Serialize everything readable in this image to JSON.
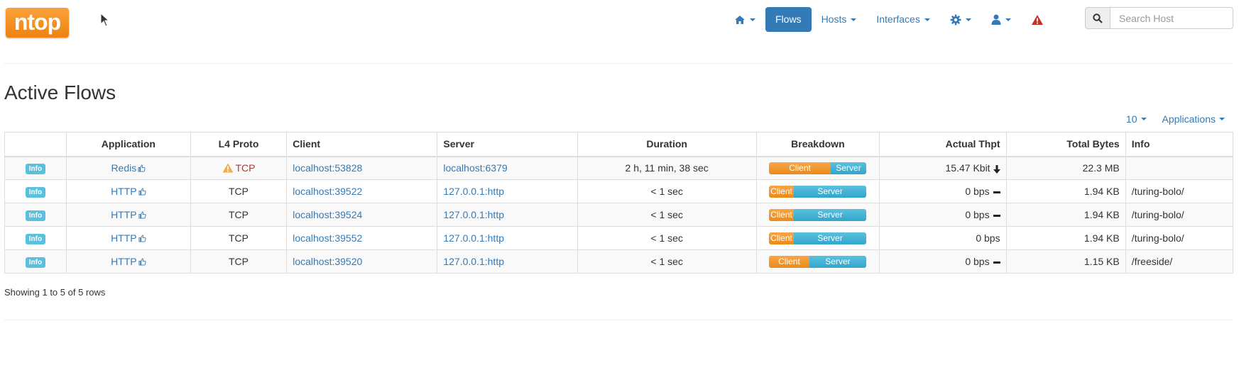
{
  "logo": "ntop",
  "nav": {
    "flows_label": "Flows",
    "hosts_label": "Hosts",
    "interfaces_label": "Interfaces"
  },
  "search": {
    "placeholder": "Search Host"
  },
  "page_title": "Active Flows",
  "table_tools": {
    "page_size": "10",
    "applications_label": "Applications"
  },
  "columns": [
    "",
    "Application",
    "L4 Proto",
    "Client",
    "Server",
    "Duration",
    "Breakdown",
    "Actual Thpt",
    "Total Bytes",
    "Info"
  ],
  "rows": [
    {
      "info": "Info",
      "app": "Redis",
      "proto": "TCP",
      "proto_warning": true,
      "client_host": "localhost",
      "client_port": ":53828",
      "server_host": "localhost",
      "server_port": ":6379",
      "duration": "2 h, 11 min, 38 sec",
      "client_label": "Client",
      "server_label": "Server",
      "client_pct": 63,
      "thpt": "15.47 Kbit",
      "trend": "down",
      "bytes": "22.3 MB",
      "info_text": ""
    },
    {
      "info": "Info",
      "app": "HTTP",
      "proto": "TCP",
      "proto_warning": false,
      "client_host": "localhost",
      "client_port": ":39522",
      "server_host": "127.0.0.1",
      "server_port": ":http",
      "duration": "< 1 sec",
      "client_label": "Client",
      "server_label": "Server",
      "client_pct": 25,
      "thpt": "0 bps",
      "trend": "flat",
      "bytes": "1.94 KB",
      "info_text": "/turing-bolo/"
    },
    {
      "info": "Info",
      "app": "HTTP",
      "proto": "TCP",
      "proto_warning": false,
      "client_host": "localhost",
      "client_port": ":39524",
      "server_host": "127.0.0.1",
      "server_port": ":http",
      "duration": "< 1 sec",
      "client_label": "Client",
      "server_label": "Server",
      "client_pct": 25,
      "thpt": "0 bps",
      "trend": "flat",
      "bytes": "1.94 KB",
      "info_text": "/turing-bolo/"
    },
    {
      "info": "Info",
      "app": "HTTP",
      "proto": "TCP",
      "proto_warning": false,
      "client_host": "localhost",
      "client_port": ":39552",
      "server_host": "127.0.0.1",
      "server_port": ":http",
      "duration": "< 1 sec",
      "client_label": "Client",
      "server_label": "Server",
      "client_pct": 25,
      "thpt": "0 bps",
      "trend": "none",
      "bytes": "1.94 KB",
      "info_text": "/turing-bolo/"
    },
    {
      "info": "Info",
      "app": "HTTP",
      "proto": "TCP",
      "proto_warning": false,
      "client_host": "localhost",
      "client_port": ":39520",
      "server_host": "127.0.0.1",
      "server_port": ":http",
      "duration": "< 1 sec",
      "client_label": "Client",
      "server_label": "Server",
      "client_pct": 41,
      "thpt": "0 bps",
      "trend": "flat",
      "bytes": "1.15 KB",
      "info_text": "/freeside/"
    }
  ],
  "showing_text": "Showing 1 to 5 of 5 rows",
  "colors": {
    "accent": "#337ab7",
    "client": "#f0932b",
    "server": "#46b8da",
    "info_badge": "#5bc0de",
    "warning": "#c9302c"
  }
}
